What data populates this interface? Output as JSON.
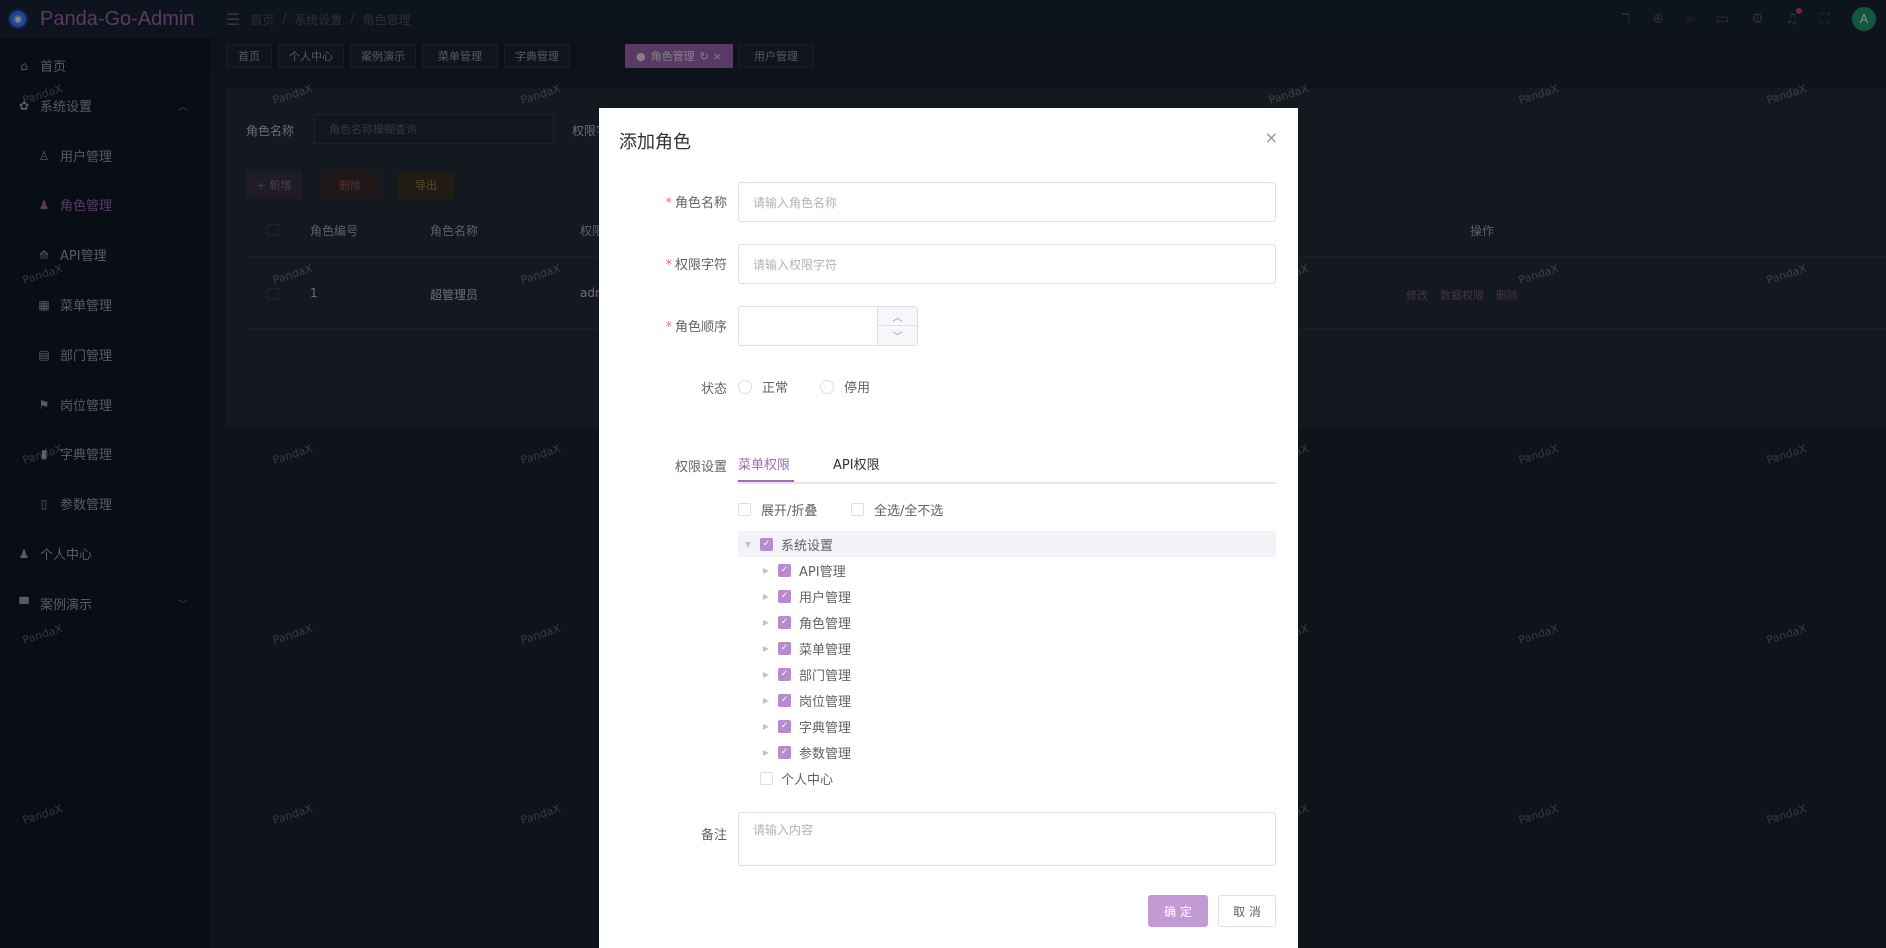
{
  "app": {
    "title": "Panda-Go-Admin",
    "logo_icon": "panda-logo-icon"
  },
  "breadcrumb": [
    "首页",
    "/",
    "系统设置",
    "/",
    "角色管理"
  ],
  "sidebar": {
    "items": [
      {
        "label": "首页",
        "icon": "home-icon"
      },
      {
        "label": "系统设置",
        "icon": "gear-icon"
      },
      {
        "label": "用户管理",
        "icon": "user-icon"
      },
      {
        "label": "角色管理",
        "icon": "role-icon"
      },
      {
        "label": "API管理",
        "icon": "api-icon"
      },
      {
        "label": "菜单管理",
        "icon": "menu-icon"
      },
      {
        "label": "部门管理",
        "icon": "dept-icon"
      },
      {
        "label": "岗位管理",
        "icon": "flag-icon"
      },
      {
        "label": "字典管理",
        "icon": "dict-icon"
      },
      {
        "label": "参数管理",
        "icon": "doc-icon"
      },
      {
        "label": "个人中心",
        "icon": "person-icon"
      },
      {
        "label": "案例演示",
        "icon": "demo-icon"
      }
    ]
  },
  "tabs": [
    {
      "label": "首页"
    },
    {
      "label": "个人中心"
    },
    {
      "label": "案例演示"
    },
    {
      "label": "菜单管理"
    },
    {
      "label": "字典管理"
    },
    {
      "label": "角色管理"
    },
    {
      "label": "用户管理"
    }
  ],
  "search": {
    "role_name_label": "角色名称",
    "role_name_placeholder": "角色名称模糊查询",
    "perm_label": "权限字"
  },
  "toolbar": {
    "add": "+ 新增",
    "delete": "删除",
    "export": "导出"
  },
  "table": {
    "headers": [
      "角色编号",
      "角色名称",
      "权限字",
      "操作"
    ],
    "rows": [
      {
        "id": "1",
        "name": "超管理员",
        "perm": "admin"
      }
    ],
    "ops": [
      "修改",
      "数据权限",
      "删除"
    ]
  },
  "watermark": "PandaX",
  "dialog": {
    "title": "添加角色",
    "close": "×",
    "role_name_label": "角色名称",
    "role_name_placeholder": "请输入角色名称",
    "perm_label": "权限字符",
    "perm_placeholder": "请输入权限字符",
    "order_label": "角色顺序",
    "status_label": "状态",
    "status_options": [
      "正常",
      "停用"
    ],
    "perm_settings_label": "权限设置",
    "perm_tabs": [
      "菜单权限",
      "API权限"
    ],
    "expand_collapse": "展开/折叠",
    "select_all": "全选/全不选",
    "tree": {
      "root": "系统设置",
      "children": [
        "API管理",
        "用户管理",
        "角色管理",
        "菜单管理",
        "部门管理",
        "岗位管理",
        "字典管理",
        "参数管理"
      ],
      "other": "个人中心"
    },
    "remark_label": "备注",
    "remark_placeholder": "请输入内容",
    "ok": "确 定",
    "cancel": "取 消"
  },
  "colors": {
    "accent": "#a16bb8",
    "sidebar_bg": "#111827",
    "topbar_bg": "#1b2535"
  }
}
